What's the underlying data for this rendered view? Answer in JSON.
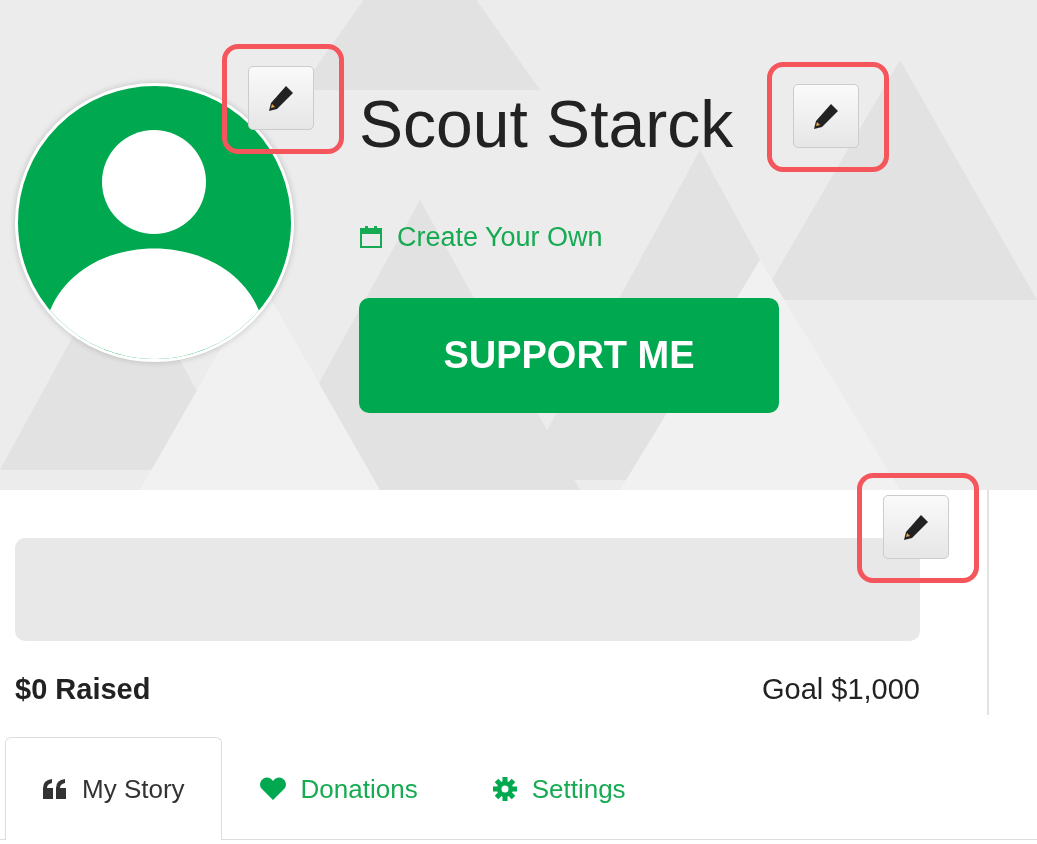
{
  "profile": {
    "name": "Scout Starck",
    "create_link": "Create Your Own",
    "support_button": "SUPPORT ME"
  },
  "edit_buttons": [
    {
      "highlighted": true
    },
    {
      "highlighted": true
    },
    {
      "highlighted": true
    }
  ],
  "progress": {
    "level": 0,
    "raised": "$0 Raised",
    "goal": "Goal $1,000"
  },
  "tabs": [
    {
      "label": "My Story",
      "kind": "quote",
      "selected": true
    },
    {
      "label": "Donations",
      "kind": "heart",
      "selected": false
    },
    {
      "label": "Settings",
      "kind": "gear",
      "selected": false
    }
  ]
}
